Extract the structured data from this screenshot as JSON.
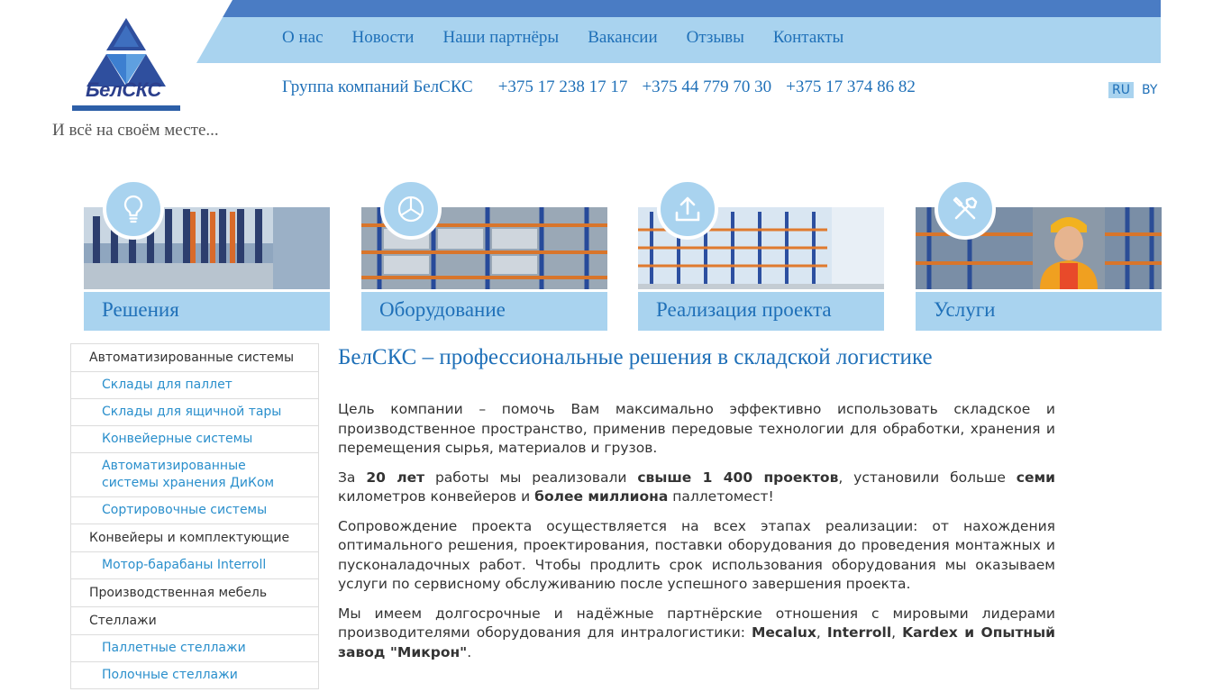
{
  "header": {
    "logo_text": "БелСКС",
    "tagline": "И всё на своём месте...",
    "nav": [
      "О нас",
      "Новости",
      "Наши партнёры",
      "Вакансии",
      "Отзывы",
      "Контакты"
    ],
    "company": "Группа компаний БелСКС",
    "phones": [
      "+375 17 238 17 17",
      "+375 44 779 70 30",
      "+375 17 374 86 82"
    ],
    "languages": [
      "RU",
      "BY"
    ],
    "active_language": "RU"
  },
  "categories": [
    {
      "label": "Решения",
      "icon": "lightbulb-icon"
    },
    {
      "label": "Оборудование",
      "icon": "cube-icon"
    },
    {
      "label": "Реализация проекта",
      "icon": "upload-icon"
    },
    {
      "label": "Услуги",
      "icon": "tools-icon"
    }
  ],
  "sidebar": {
    "items": [
      {
        "label": "Автоматизированные системы",
        "level": "category"
      },
      {
        "label": "Склады для паллет",
        "level": "sub"
      },
      {
        "label": "Склады для ящичной тары",
        "level": "sub"
      },
      {
        "label": "Конвейерные системы",
        "level": "sub"
      },
      {
        "label": "Автоматизированные системы хранения ДиКом",
        "level": "sub"
      },
      {
        "label": "Сортировочные системы",
        "level": "sub"
      },
      {
        "label": "Конвейеры и комплектующие",
        "level": "category"
      },
      {
        "label": "Мотор-барабаны Interroll",
        "level": "sub"
      },
      {
        "label": "Производственная мебель",
        "level": "category"
      },
      {
        "label": "Стеллажи",
        "level": "category"
      },
      {
        "label": "Паллетные стеллажи",
        "level": "sub"
      },
      {
        "label": "Полочные стеллажи",
        "level": "sub"
      }
    ]
  },
  "main": {
    "title": "БелСКС – профессиональные решения в складской логистике",
    "p1": "Цель компании – помочь Вам максимально эффективно использовать складское и производственное пространство, применив передовые технологии для обработки, хранения и перемещения сырья, материалов и грузов.",
    "p2": {
      "t1": "За ",
      "b1": "20 лет",
      "t2": " работы мы реализовали ",
      "b2": "свыше 1 400 проектов",
      "t3": ", установили больше ",
      "b3": "семи",
      "t4": " километров конвейеров и ",
      "b4": "более миллиона",
      "t5": " паллетомест!"
    },
    "p3": "Сопровождение проекта осуществляется на всех этапах реализации: от нахождения оптимального решения, проектирования, поставки оборудования до проведения монтажных и пусконаладочных работ. Чтобы продлить срок использования оборудования мы оказываем услуги по сервисному обслуживанию после успешного завершения проекта.",
    "p4": {
      "t1": "Мы имеем долгосрочные и надёжные партнёрские отношения с мировыми лидерами производителями оборудования для интралогистики: ",
      "b1": "Mecalux",
      "t2": ", ",
      "b2": "Interroll",
      "t3": ", ",
      "b3": "Kardex и Опытный завод \"Микрон\"",
      "t4": "."
    }
  },
  "colors": {
    "brand_blue": "#1f70b8",
    "band_light": "#a9d3ef",
    "top_bar": "#4a7cc4",
    "sidebar_link": "#2a8fcc"
  }
}
